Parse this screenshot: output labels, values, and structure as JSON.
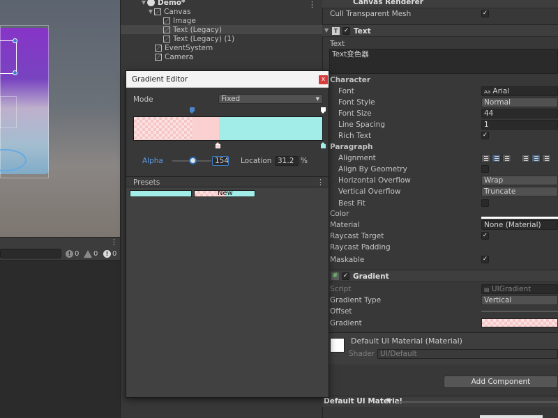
{
  "hierarchy": {
    "items": [
      {
        "label": "Demo*",
        "indent": 0
      },
      {
        "label": "Canvas",
        "indent": 1
      },
      {
        "label": "Image",
        "indent": 2
      },
      {
        "label": "Text (Legacy)",
        "indent": 2
      },
      {
        "label": "Text (Legacy) (1)",
        "indent": 2
      },
      {
        "label": "EventSystem",
        "indent": 1
      },
      {
        "label": "Camera",
        "indent": 1
      }
    ]
  },
  "console": {
    "info_count": "0",
    "warning_count": "0",
    "error_count": "0"
  },
  "gradient_editor": {
    "title": "Gradient Editor",
    "close_label": "x",
    "mode_label": "Mode",
    "mode_value": "Fixed",
    "alpha_label": "Alpha",
    "alpha_value": "154",
    "location_label": "Location",
    "location_value": "31.2",
    "percent": "%",
    "presets_label": "Presets",
    "new_preset_label": "New",
    "colors": {
      "left": "#fbd0d0",
      "right": "#a3ede8"
    }
  },
  "inspector": {
    "canvas_renderer": {
      "title": "Canvas Renderer",
      "cull_label": "Cull Transparent Mesh",
      "cull_checked": "✓"
    },
    "text": {
      "title": "Text",
      "enabled": "✓",
      "text_label": "Text",
      "text_value": "Text变色器",
      "character_header": "Character",
      "font_label": "Font",
      "font_value": "Arial",
      "font_style_label": "Font Style",
      "font_style_value": "Normal",
      "font_size_label": "Font Size",
      "font_size_value": "44",
      "line_spacing_label": "Line Spacing",
      "line_spacing_value": "1",
      "rich_text_label": "Rich Text",
      "rich_text_checked": "✓",
      "paragraph_header": "Paragraph",
      "alignment_label": "Alignment",
      "align_by_geometry_label": "Align By Geometry",
      "horizontal_overflow_label": "Horizontal Overflow",
      "horizontal_overflow_value": "Wrap",
      "vertical_overflow_label": "Vertical Overflow",
      "vertical_overflow_value": "Truncate",
      "best_fit_label": "Best Fit",
      "color_label": "Color",
      "material_label": "Material",
      "material_value": "None (Material)",
      "raycast_target_label": "Raycast Target",
      "raycast_target_checked": "✓",
      "raycast_padding_label": "Raycast Padding",
      "maskable_label": "Maskable",
      "maskable_checked": "✓"
    },
    "gradient": {
      "title": "Gradient",
      "enabled": "✓",
      "script_label": "Script",
      "script_value": "UIGradient",
      "gradient_type_label": "Gradient Type",
      "gradient_type_value": "Vertical",
      "offset_label": "Offset",
      "gradient_label": "Gradient"
    },
    "material": {
      "name": "Default UI Material (Material)",
      "shader_label": "Shader",
      "shader_value": "UI/Default"
    },
    "add_component_label": "Add Component",
    "material_strip_label": "Default UI Material"
  }
}
